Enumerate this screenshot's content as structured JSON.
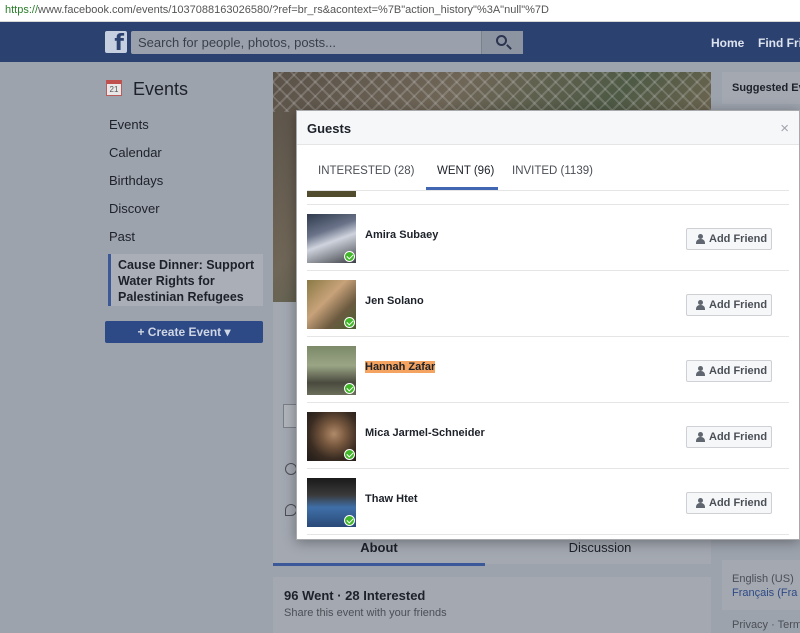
{
  "browser": {
    "url_protocol": "https://",
    "url_rest": "www.facebook.com/events/1037088163026580/?ref=br_rs&acontext=%7B\"action_history\"%3A\"null\"%7D"
  },
  "header": {
    "logo": "f",
    "search_placeholder": "Search for people, photos, posts...",
    "nav": [
      "Home",
      "Find Frie"
    ]
  },
  "sidebar": {
    "calendar_day": "21",
    "title": "Events",
    "links": [
      "Events",
      "Calendar",
      "Birthdays",
      "Discover",
      "Past"
    ],
    "active_event": "Cause Dinner: Support Water Rights for Palestinian Refugees",
    "create_button": "+ Create Event ▾"
  },
  "event_page": {
    "tabs": [
      "About",
      "Discussion"
    ],
    "stats_title": "96 Went · 28 Interested",
    "stats_sub": "Share this event with your friends"
  },
  "right_column": {
    "suggested": "Suggested Eve",
    "language_current": "English (US)",
    "language_alt": "Français (Fra",
    "footer": "Privacy · Terms"
  },
  "modal": {
    "title": "Guests",
    "close": "×",
    "tabs": [
      "INTERESTED (28)",
      "WENT (96)",
      "INVITED (1139)"
    ],
    "add_friend_label": "Add Friend",
    "guests": [
      {
        "name": "Amira Subaey",
        "highlighted": false
      },
      {
        "name": "Jen Solano",
        "highlighted": false
      },
      {
        "name": "Hannah Zafar",
        "highlighted": true
      },
      {
        "name": "Mica Jarmel-Schneider",
        "highlighted": false
      },
      {
        "name": "Thaw Htet",
        "highlighted": false
      }
    ]
  },
  "colors": {
    "fb_blue": "#3b5998",
    "highlight": "#f4a460",
    "went_check": "#42b72a"
  }
}
